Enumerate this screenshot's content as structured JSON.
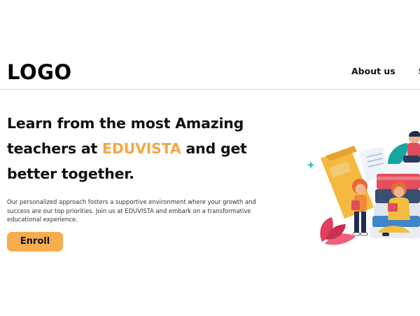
{
  "header": {
    "logo": "LOGO",
    "nav": [
      "About us",
      "Sk"
    ]
  },
  "hero": {
    "line1": "Learn from the most Amazing",
    "line2_pre": "teachers at ",
    "line2_accent": "EDUVISTA",
    "line2_post": " and get",
    "line3": "better together.",
    "description": "Our personalized approach fosters a supportive environment where your growth and success are our top priorities. Join us at EDUVISTA and embark on a transformative educational experience.",
    "cta": "Enroll"
  },
  "colors": {
    "accent": "#f4a847",
    "button": "#f6ad4e",
    "divider": "#d6d6d6"
  },
  "illustration": {
    "subject": "students-reading-books-with-stack-of-books"
  }
}
